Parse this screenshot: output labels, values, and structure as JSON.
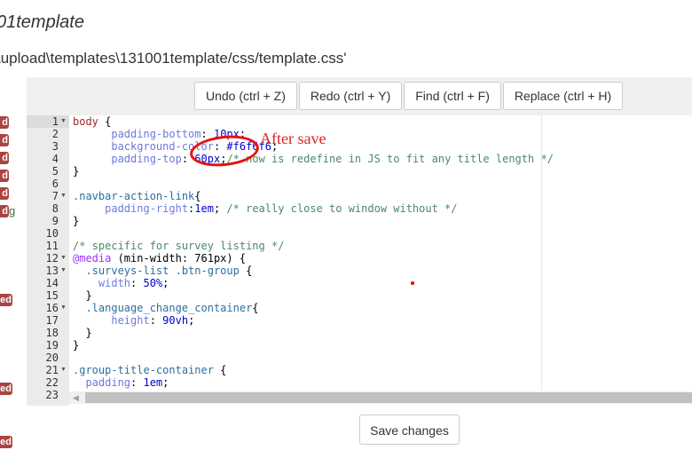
{
  "header": {
    "title": "01template",
    "path": "\\upload\\templates\\131001template/css/template.css'"
  },
  "side_badges": [
    "d",
    "d",
    "d",
    "d",
    "d",
    "d",
    "ed",
    "ed",
    "ed"
  ],
  "side_text": "g",
  "toolbar": {
    "undo": "Undo (ctrl + Z)",
    "redo": "Redo (ctrl + Y)",
    "find": "Find (ctrl + F)",
    "replace": "Replace (ctrl + H)"
  },
  "annotation": "After save",
  "save_label": "Save changes",
  "folds": [
    1,
    7,
    12,
    13,
    16,
    21
  ],
  "lines": [
    [
      [
        "sel",
        "body"
      ],
      [
        "p",
        " {"
      ]
    ],
    [
      [
        "p",
        "      "
      ],
      [
        "prop",
        "padding-bottom"
      ],
      [
        "p",
        ": "
      ],
      [
        "num",
        "10px"
      ],
      [
        "p",
        ";"
      ]
    ],
    [
      [
        "p",
        "      "
      ],
      [
        "prop",
        "background-color"
      ],
      [
        "p",
        ": "
      ],
      [
        "num",
        "#f6f6f6"
      ],
      [
        "p",
        ";"
      ]
    ],
    [
      [
        "p",
        "      "
      ],
      [
        "prop",
        "padding-top"
      ],
      [
        "p",
        ": "
      ],
      [
        "num",
        "60px"
      ],
      [
        "p",
        ";"
      ],
      [
        "com",
        "/* now is redefine in JS to fit any title length */"
      ]
    ],
    [
      [
        "p",
        "}"
      ]
    ],
    [
      [
        "p",
        ""
      ]
    ],
    [
      [
        "cls",
        ".navbar-action-link"
      ],
      [
        "p",
        "{"
      ]
    ],
    [
      [
        "p",
        "     "
      ],
      [
        "prop",
        "padding-right"
      ],
      [
        "p",
        ":"
      ],
      [
        "num",
        "1em"
      ],
      [
        "p",
        "; "
      ],
      [
        "com",
        "/* really close to window without */"
      ]
    ],
    [
      [
        "p",
        "}"
      ]
    ],
    [
      [
        "p",
        ""
      ]
    ],
    [
      [
        "com",
        "/* specific for survey listing */"
      ]
    ],
    [
      [
        "kw",
        "@media"
      ],
      [
        "p",
        " (min-width: 761px) {"
      ]
    ],
    [
      [
        "p",
        "  "
      ],
      [
        "cls",
        ".surveys-list .btn-group"
      ],
      [
        "p",
        " {"
      ]
    ],
    [
      [
        "p",
        "    "
      ],
      [
        "prop",
        "width"
      ],
      [
        "p",
        ": "
      ],
      [
        "num",
        "50%"
      ],
      [
        "p",
        ";"
      ]
    ],
    [
      [
        "p",
        "  }"
      ]
    ],
    [
      [
        "p",
        "  "
      ],
      [
        "cls",
        ".language_change_container"
      ],
      [
        "p",
        "{"
      ]
    ],
    [
      [
        "p",
        "      "
      ],
      [
        "prop",
        "height"
      ],
      [
        "p",
        ": "
      ],
      [
        "num",
        "90vh"
      ],
      [
        "p",
        ";"
      ]
    ],
    [
      [
        "p",
        "  }"
      ]
    ],
    [
      [
        "p",
        "}"
      ]
    ],
    [
      [
        "p",
        ""
      ]
    ],
    [
      [
        "cls",
        ".group-title-container"
      ],
      [
        "p",
        " {"
      ]
    ],
    [
      [
        "p",
        "  "
      ],
      [
        "prop",
        "padding"
      ],
      [
        "p",
        ": "
      ],
      [
        "num",
        "1em"
      ],
      [
        "p",
        ";"
      ]
    ],
    [
      [
        "p",
        ""
      ]
    ]
  ]
}
